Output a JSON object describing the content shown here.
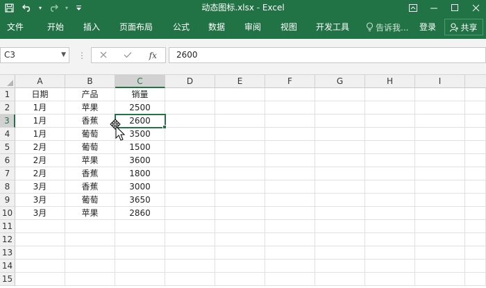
{
  "window": {
    "title": "动态图标.xlsx - Excel",
    "controls": [
      "ribbon-display-icon",
      "minimize-icon",
      "maximize-icon",
      "close-icon"
    ]
  },
  "quick_access": {
    "icons": [
      "save-icon",
      "undo-icon",
      "redo-icon",
      "customize-icon"
    ]
  },
  "ribbon": {
    "tabs": [
      {
        "label": "文件"
      },
      {
        "label": "开始"
      },
      {
        "label": "插入"
      },
      {
        "label": "页面布局"
      },
      {
        "label": "公式"
      },
      {
        "label": "数据"
      },
      {
        "label": "审阅"
      },
      {
        "label": "视图"
      },
      {
        "label": "开发工具"
      }
    ],
    "tell_me": "告诉我...",
    "login": "登录",
    "share": "共享"
  },
  "formula_bar": {
    "name_box": "C3",
    "fx_label": "fx",
    "value": "2600"
  },
  "sheet": {
    "columns": [
      "A",
      "B",
      "C",
      "D",
      "E",
      "F",
      "G",
      "H",
      "I"
    ],
    "rows": [
      "1",
      "2",
      "3",
      "4",
      "5",
      "6",
      "7",
      "8",
      "9",
      "10",
      "11",
      "12",
      "13",
      "14",
      "15"
    ],
    "active_cell": "C3",
    "cells": [
      [
        "日期",
        "产品",
        "销量"
      ],
      [
        "1月",
        "苹果",
        "2500"
      ],
      [
        "1月",
        "香蕉",
        "2600"
      ],
      [
        "1月",
        "葡萄",
        "3500"
      ],
      [
        "2月",
        "葡萄",
        "1500"
      ],
      [
        "2月",
        "苹果",
        "3600"
      ],
      [
        "2月",
        "香蕉",
        "1800"
      ],
      [
        "3月",
        "香蕉",
        "3000"
      ],
      [
        "3月",
        "葡萄",
        "3650"
      ],
      [
        "3月",
        "苹果",
        "2860"
      ]
    ]
  },
  "theme": {
    "accent": "#217346"
  }
}
